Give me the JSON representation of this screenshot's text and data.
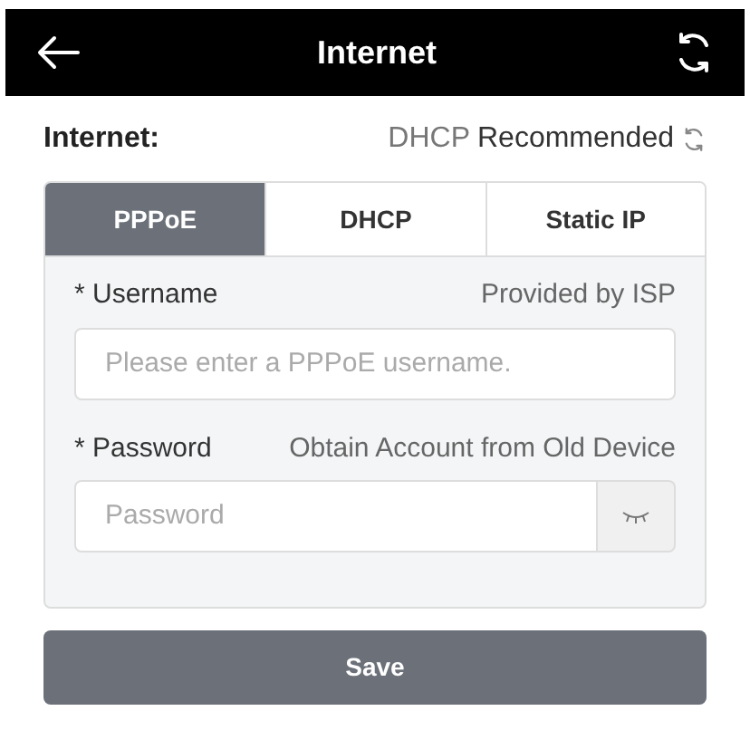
{
  "header": {
    "title": "Internet"
  },
  "internet": {
    "label": "Internet:",
    "mode": "DHCP",
    "note": "Recommended"
  },
  "tabs": [
    {
      "label": "PPPoE",
      "selected": true
    },
    {
      "label": "DHCP",
      "selected": false
    },
    {
      "label": "Static IP",
      "selected": false
    }
  ],
  "fields": [
    {
      "kind": "text",
      "label": "* Username",
      "hint": "Provided by ISP",
      "placeholder": "Please enter a PPPoE username."
    },
    {
      "kind": "password",
      "label": "* Password",
      "hint": "Obtain Account from Old Device",
      "placeholder": "Password"
    }
  ],
  "save": "Save"
}
